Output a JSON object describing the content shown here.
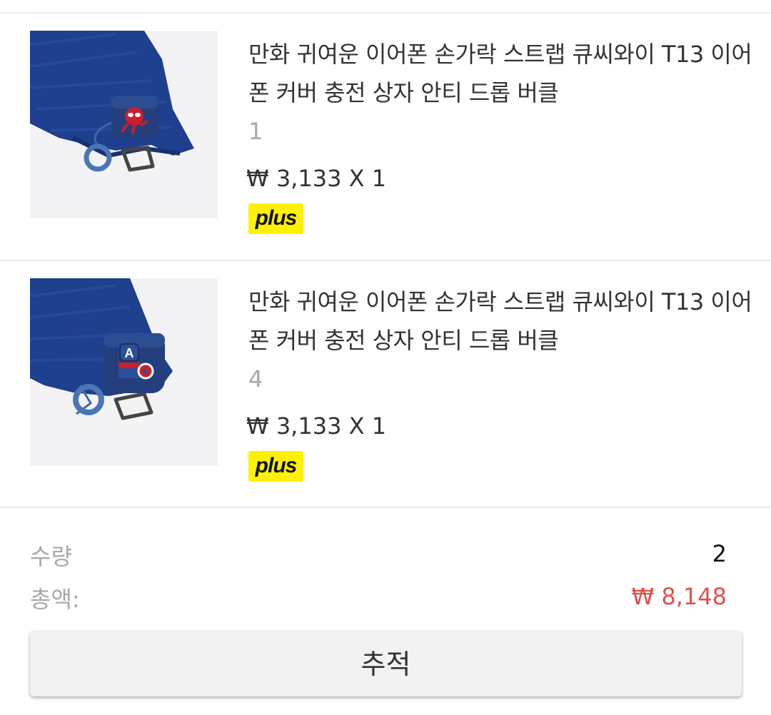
{
  "items": [
    {
      "title": "만화 귀여운 이어폰 손가락 스트랩 큐씨와이 T13 이어폰 커버 충전 상자 안티 드롭 버클",
      "option": "1",
      "price": "₩ 3,133 X 1",
      "badge": "plus",
      "character_icon": "spider-hero-icon"
    },
    {
      "title": "만화 귀여운 이어폰 손가락 스트랩 큐씨와이 T13 이어폰 커버 충전 상자 안티 드롭 버클",
      "option": "4",
      "price": "₩ 3,133 X 1",
      "badge": "plus",
      "character_icon": "captain-hero-icon"
    }
  ],
  "summary": {
    "quantity_label": "수량",
    "quantity_value": "2",
    "total_label": "총액:",
    "total_value": "₩ 8,148"
  },
  "track_button_label": "추적",
  "colors": {
    "total_price": "#d9534f",
    "badge_bg": "#fff200",
    "muted_text": "#a8a8a8",
    "cloth": "#1f3f8f",
    "case": "#243f7c"
  }
}
